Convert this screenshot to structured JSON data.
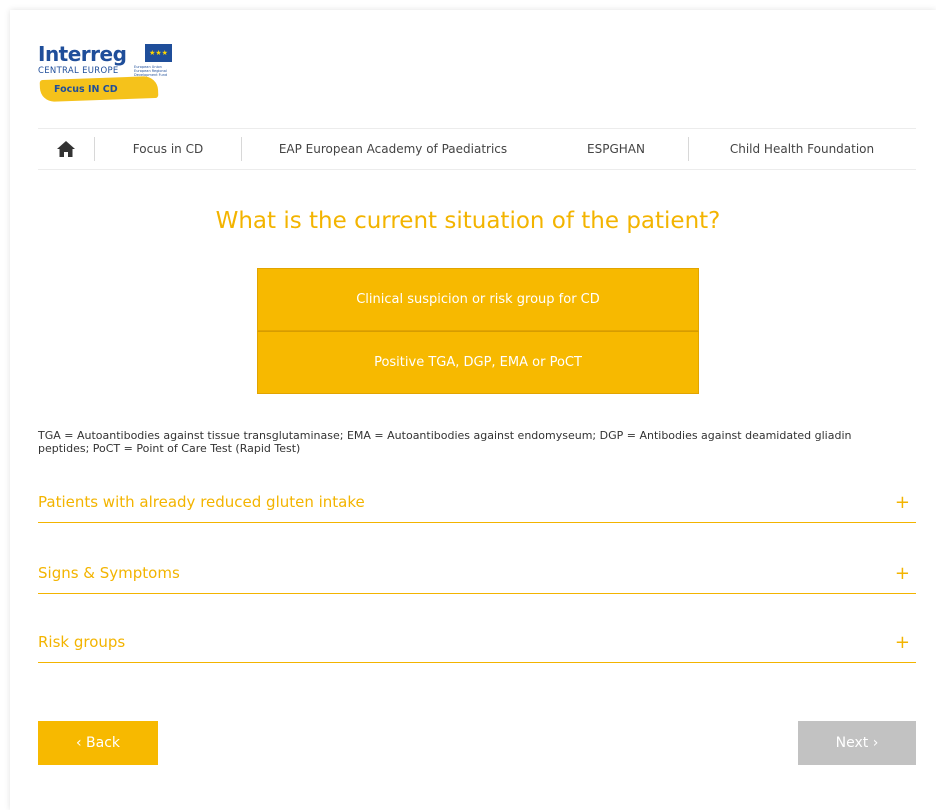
{
  "logo": {
    "brand": "Interreg",
    "region": "CENTRAL EUROPE",
    "project": "Focus IN CD",
    "eu_text": "European Union European Regional Development Fund"
  },
  "nav": {
    "items": [
      {
        "label": "Focus in CD"
      },
      {
        "label": "EAP European Academy of Paediatrics"
      },
      {
        "label": "ESPGHAN"
      },
      {
        "label": "Child Health Foundation"
      }
    ]
  },
  "question": "What is the current situation of the patient?",
  "options": [
    {
      "label": "Clinical suspicion or risk group for CD"
    },
    {
      "label": "Positive TGA, DGP, EMA or PoCT"
    }
  ],
  "footnote": "TGA = Autoantibodies against tissue transglutaminase; EMA = Autoantibodies against endomyseum; DGP = Antibodies against deamidated gliadin peptides; PoCT = Point of Care Test (Rapid Test)",
  "accordion": [
    {
      "label": "Patients with already reduced gluten intake",
      "icon": "+"
    },
    {
      "label": "Signs & Symptoms",
      "icon": "+"
    },
    {
      "label": "Risk groups",
      "icon": "+"
    }
  ],
  "buttons": {
    "back": "‹  Back",
    "next": "Next  ›"
  },
  "colors": {
    "accent": "#f7b900",
    "disabled": "#c2c2c2",
    "brand_blue": "#1f4e9a"
  }
}
